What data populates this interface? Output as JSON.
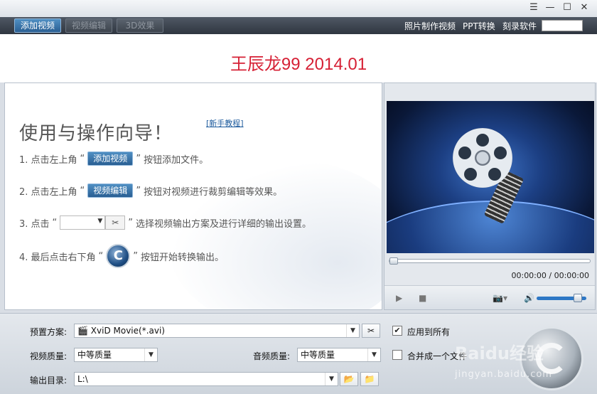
{
  "window": {
    "menu_icon": "menu-icon",
    "minimize_icon": "minimize-icon",
    "maximize_icon": "maximize-icon",
    "close_icon": "close-icon"
  },
  "toolbar": {
    "add_video": "添加视频",
    "edit_video": "视频编辑",
    "effect_3d": "3D效果",
    "photo_video": "照片制作视频",
    "ppt_convert": "PPT转换",
    "burn_software": "刻录软件"
  },
  "banner": {
    "title": "王辰龙99 2014.01"
  },
  "guide": {
    "title": "使用与操作向导！",
    "tutorial_link": "[新手教程]",
    "step1": {
      "pre": "1. 点击左上角",
      "btn": "添加视频",
      "post": "按钮添加文件。"
    },
    "step2": {
      "pre": "2. 点击左上角",
      "btn": "视频编辑",
      "post": "按钮对视频进行裁剪编辑等效果。"
    },
    "step3": {
      "pre": "3. 点击",
      "post": "选择视频输出方案及进行详细的输出设置。"
    },
    "step4": {
      "pre": "4. 最后点击右下角",
      "post": "按钮开始转换输出。"
    },
    "quote_open": "“",
    "quote_close": "”"
  },
  "preview": {
    "time": "00:00:00 / 00:00:00",
    "seek_fraction": 0,
    "volume_fraction": 0.9
  },
  "output": {
    "preset_label": "预置方案:",
    "preset_value": "XviD Movie(*.avi)",
    "video_quality_label": "视频质量:",
    "video_quality_value": "中等质量",
    "audio_quality_label": "音频质量:",
    "audio_quality_value": "中等质量",
    "output_dir_label": "输出目录:",
    "output_dir_value": "L:\\",
    "apply_all_label": "应用到所有",
    "apply_all_checked": true,
    "merge_label": "合并成一个文件",
    "merge_checked": false
  },
  "watermark": {
    "brand": "Baidu经验",
    "url": "jingyan.baidu.com"
  }
}
